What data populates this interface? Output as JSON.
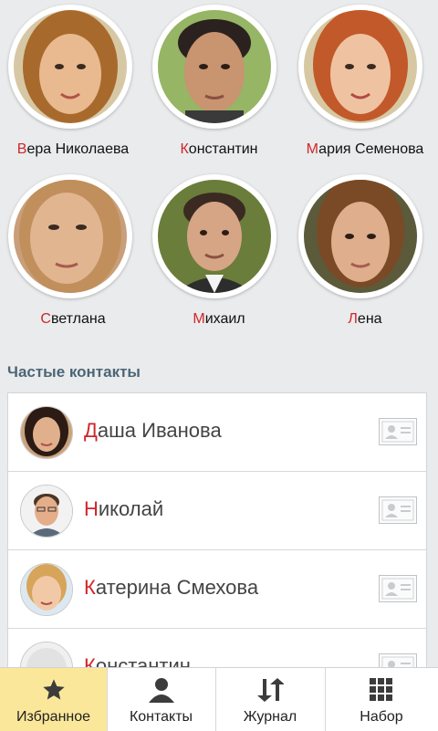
{
  "favorites": [
    {
      "name_first": "В",
      "name_rest": "ера Николаева",
      "skin": "#e9b98f",
      "hair": "#a86a2c",
      "bg": "#d7c8a5"
    },
    {
      "name_first": "К",
      "name_rest": "онстантин",
      "skin": "#c99470",
      "hair": "#2b2220",
      "bg": "#96b565"
    },
    {
      "name_first": "М",
      "name_rest": "ария Семенова",
      "skin": "#efc3a1",
      "hair": "#c2592a",
      "bg": "#d6c8a2"
    },
    {
      "name_first": "С",
      "name_rest": "ветлана",
      "skin": "#e2b591",
      "hair": "#c08f5c",
      "bg": "#c89f7a"
    },
    {
      "name_first": "М",
      "name_rest": "ихаил",
      "skin": "#d6a585",
      "hair": "#3a2a22",
      "bg": "#6a7d3a"
    },
    {
      "name_first": "Л",
      "name_rest": "ена",
      "skin": "#dfae8c",
      "hair": "#7a4a26",
      "bg": "#5b5a3a"
    }
  ],
  "frequent": {
    "title": "Частые контакты",
    "items": [
      {
        "name_first": "Д",
        "name_rest": "аша Иванова",
        "skin": "#e0b08d",
        "hair": "#2b1b14"
      },
      {
        "name_first": "Н",
        "name_rest": "иколай",
        "skin": "#e4ae8a",
        "hair": "#4a3526"
      },
      {
        "name_first": "К",
        "name_rest": "атерина Смехова",
        "skin": "#f2c9a6",
        "hair": "#d6a55a"
      },
      {
        "name_first": "К",
        "name_rest": "онстантин",
        "skin": "#eeeeee",
        "hair": "#dddddd"
      }
    ]
  },
  "tabs": [
    {
      "label": "Избранное",
      "icon": "star-icon",
      "active": true
    },
    {
      "label": "Контакты",
      "icon": "person-icon",
      "active": false
    },
    {
      "label": "Журнал",
      "icon": "arrows-updown-icon",
      "active": false
    },
    {
      "label": "Набор",
      "icon": "dialpad-icon",
      "active": false
    }
  ],
  "colors": {
    "accent_letter": "#d0262a",
    "active_tab": "#fbe79a",
    "section_title": "#4d6576"
  }
}
